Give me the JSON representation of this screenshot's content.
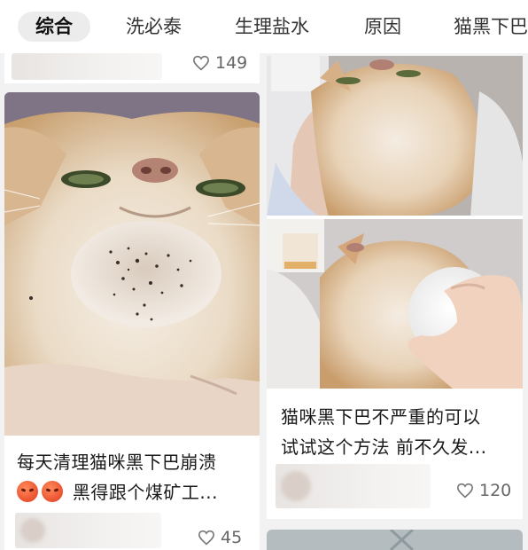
{
  "tabs": [
    {
      "label": "综合",
      "active": true
    },
    {
      "label": "洗必泰",
      "active": false
    },
    {
      "label": "生理盐水",
      "active": false
    },
    {
      "label": "原因",
      "active": false
    },
    {
      "label": "猫黑下巴",
      "active": false
    }
  ],
  "cards": {
    "top_left": {
      "likes": "149"
    },
    "left": {
      "title_line1": "每天清理猫咪黑下巴崩溃",
      "title_line2": "黑得跟个煤矿工...",
      "emoji_icons": [
        "angry-face-icon",
        "angry-face-icon"
      ],
      "likes": "45"
    },
    "right": {
      "title_line1": "猫咪黑下巴不严重的可以",
      "title_line2": "试试这个方法 前不久发...",
      "likes": "120"
    }
  },
  "colors": {
    "background": "#f2f2f2",
    "card": "#ffffff",
    "active_tab": "#ececec"
  }
}
